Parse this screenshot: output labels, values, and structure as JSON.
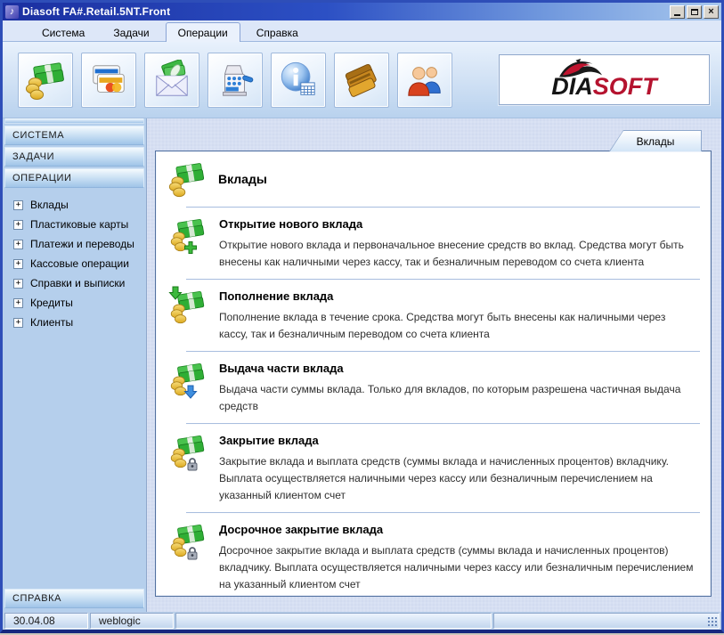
{
  "colors": {
    "titlebar_left": "#1b2fa0",
    "titlebar_right": "#a8c8ee",
    "frame_blue": "#2e4eb8",
    "logo_red": "#b5132f",
    "sidebar_bg": "#b5cfec",
    "panel_border": "#52709f"
  },
  "window": {
    "title": "Diasoft FA#.Retail.5NT.Front",
    "icon": "music-note-icon",
    "controls": [
      {
        "name": "minimize"
      },
      {
        "name": "maximize"
      },
      {
        "name": "close"
      }
    ]
  },
  "menu": {
    "items": [
      {
        "label": "Система",
        "selected": false
      },
      {
        "label": "Задачи",
        "selected": false
      },
      {
        "label": "Операции",
        "selected": true
      },
      {
        "label": "Справка",
        "selected": false
      }
    ]
  },
  "toolbar": {
    "buttons": [
      {
        "icon": "money-icon"
      },
      {
        "icon": "bank-cards-icon"
      },
      {
        "icon": "envelope-money-icon"
      },
      {
        "icon": "cash-register-icon"
      },
      {
        "icon": "info-icon"
      },
      {
        "icon": "wallet-icon"
      },
      {
        "icon": "clients-icon"
      }
    ],
    "logo": {
      "dia": "DIA",
      "soft": "SOFT",
      "icon": "dolphin-icon"
    }
  },
  "sidebar": {
    "expander": "+",
    "sections": [
      {
        "label": "СИСТЕМА"
      },
      {
        "label": "ЗАДАЧИ"
      },
      {
        "label": "ОПЕРАЦИИ"
      }
    ],
    "tree": [
      {
        "label": "Вклады"
      },
      {
        "label": "Пластиковые карты"
      },
      {
        "label": "Платежи и переводы"
      },
      {
        "label": "Кассовые операции"
      },
      {
        "label": "Справки и выписки"
      },
      {
        "label": "Кредиты"
      },
      {
        "label": "Клиенты"
      }
    ],
    "bottom_section": {
      "label": "СПРАВКА"
    }
  },
  "main": {
    "tab": "Вклады",
    "heading": "Вклады",
    "heading_icon": "money-icon",
    "operations": [
      {
        "title": "Открытие нового вклада",
        "overlay": "plus-icon",
        "description": "Открытие нового вклада и первоначальное внесение средств во вклад. Средства могут быть внесены как наличными через кассу, так и безналичным переводом со счета клиента"
      },
      {
        "title": "Пополнение вклада",
        "overlay": "arrow-down-green-icon",
        "description": "Пополнение вклада в течение срока. Средства могут быть внесены как наличными через кассу, так и безналичным переводом со счета клиента"
      },
      {
        "title": "Выдача части вклада",
        "overlay": "arrow-down-blue-icon",
        "description": "Выдача части суммы вклада. Только для вкладов, по которым разрешена частичная выдача средств"
      },
      {
        "title": "Закрытие вклада",
        "overlay": "lock-icon",
        "description": "Закрытие вклада и выплата средств (суммы вклада и начисленных процентов) вкладчику. Выплата осуществляется наличными через кассу или безналичным перечислением на указанный клиентом счет"
      },
      {
        "title": "Досрочное закрытие вклада",
        "overlay": "lock-icon",
        "description": "Досрочное закрытие вклада и выплата средств (суммы вклада и начисленных процентов) вкладчику. Выплата осуществляется наличными через кассу или безналичным перечислением на указанный клиентом счет"
      }
    ]
  },
  "statusbar": {
    "date": "30.04.08",
    "user": "weblogic"
  }
}
